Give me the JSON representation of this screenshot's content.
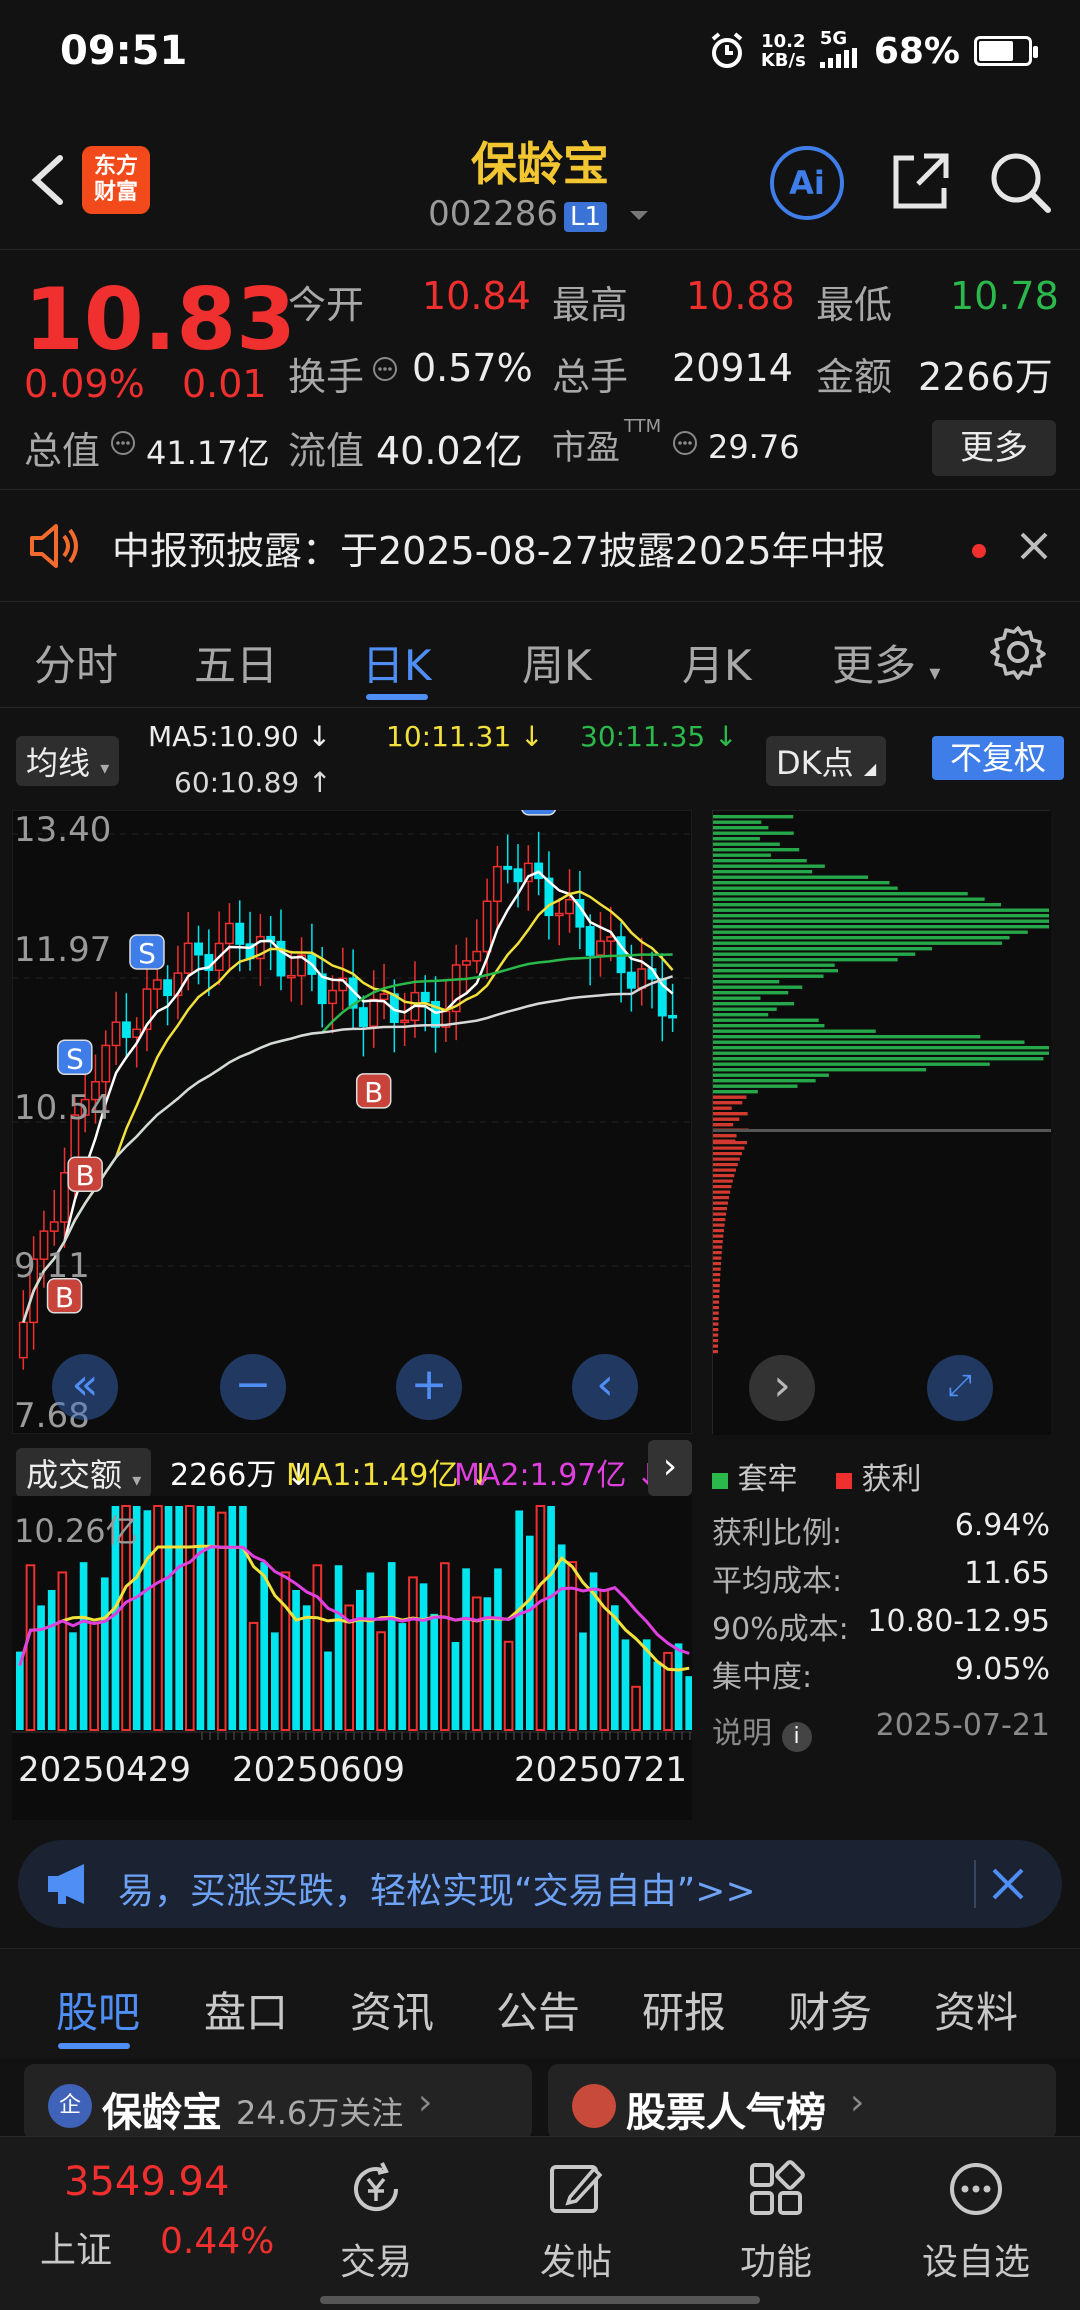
{
  "status": {
    "time": "09:51",
    "net_speed_value": "10.2",
    "net_speed_unit": "KB/s",
    "signal": "5G",
    "battery": "68%",
    "battery_level": 0.68
  },
  "header": {
    "logo_line1": "东方",
    "logo_line2": "财富",
    "title": "保龄宝",
    "code": "002286",
    "level": "L1",
    "ai": "Ai"
  },
  "quote": {
    "price": "10.83",
    "pct": "0.09%",
    "change": "0.01",
    "open_label": "今开",
    "open": "10.84",
    "high_label": "最高",
    "high": "10.88",
    "low_label": "最低",
    "low": "10.78",
    "turnover_label": "换手",
    "turnover": "0.57%",
    "volume_label": "总手",
    "volume": "20914",
    "amount_label": "金额",
    "amount": "2266万",
    "mcap_label": "总值",
    "mcap": "41.17亿",
    "float_label": "流值",
    "float": "40.02亿",
    "pe_label": "市盈",
    "pe_sup": "TTM",
    "pe": "29.76",
    "more": "更多"
  },
  "notice": {
    "text": "中报预披露：于2025-08-27披露2025年中报"
  },
  "tabs": [
    "分时",
    "五日",
    "日K",
    "周K",
    "月K",
    "更多"
  ],
  "chart_toolbar": {
    "ma_label": "均线",
    "ma5": "MA5:10.90 ↓",
    "ma10": "10:11.31 ↓",
    "ma30": "30:11.35 ↓",
    "ma60": "60:10.89 ↑",
    "dk_label": "DK点",
    "fq_label": "不复权"
  },
  "kline": {
    "y_labels": [
      "13.40",
      "11.97",
      "10.54",
      "9.11",
      "7.68"
    ],
    "signals": [
      {
        "text": "S"
      },
      {
        "text": "B"
      },
      {
        "text": "S"
      },
      {
        "text": "B"
      },
      {
        "text": "B"
      },
      {
        "text": "S"
      }
    ]
  },
  "volume": {
    "label": "成交额",
    "value": "2266万 ↓",
    "ma1": "MA1:1.49亿 ↓",
    "ma2": "MA2:1.97亿 ↓",
    "max_label": "10.26亿",
    "dates": [
      "20250429",
      "20250609",
      "20250721"
    ]
  },
  "chip": {
    "legend_trapped": "套牢",
    "legend_profit": "获利",
    "profit_ratio_label": "获利比例:",
    "profit_ratio": "6.94%",
    "avg_cost_label": "平均成本:",
    "avg_cost": "11.65",
    "cost90_label": "90%成本:",
    "cost90": "10.80-12.95",
    "concentration_label": "集中度:",
    "concentration": "9.05%",
    "note_label": "说明",
    "date": "2025-07-21"
  },
  "banner": {
    "text": "易，买涨买跌，轻松实现“交易自由”>>"
  },
  "bottom_tabs": [
    "股吧",
    "盘口",
    "资讯",
    "公告",
    "研报",
    "财务",
    "资料"
  ],
  "cards": {
    "stock_name": "保龄宝",
    "followers": "24.6万关注",
    "rank_title": "股票人气榜",
    "badge": "企"
  },
  "nav": {
    "index_value": "3549.94",
    "index_name": "上证",
    "index_pct": "0.44%",
    "trade": "交易",
    "post": "发帖",
    "function": "功能",
    "watchlist": "设自选"
  },
  "colors": {
    "up": "#f0302f",
    "down": "#00e5ee",
    "accent": "#4f8ef5",
    "title": "#f2c630",
    "ma5": "#ffffff",
    "ma10": "#f2e13a",
    "ma30": "#2bb94c",
    "ma60": "#d8d8d8"
  },
  "chart_data": {
    "type": "bar",
    "x": [
      "20250429",
      "20250609",
      "20250721"
    ],
    "series": [
      {
        "name": "MA5",
        "values": [
          10.9
        ]
      },
      {
        "name": "MA10",
        "values": [
          11.31
        ]
      },
      {
        "name": "MA30",
        "values": [
          11.35
        ]
      },
      {
        "name": "MA60",
        "values": [
          10.89
        ]
      }
    ],
    "ylim": [
      7.68,
      13.4
    ]
  }
}
